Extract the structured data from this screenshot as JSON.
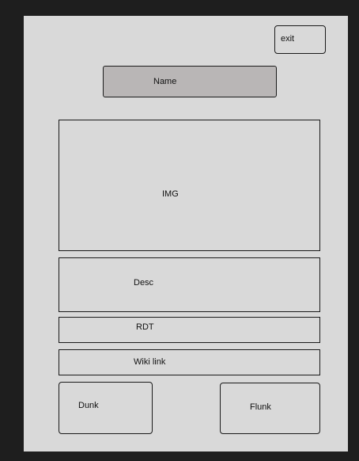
{
  "header": {
    "exit_label": "exit",
    "name_label": "Name"
  },
  "content": {
    "image_label": "IMG",
    "description_label": "Desc",
    "rdt_label": "RDT",
    "wiki_link_label": "Wiki link"
  },
  "actions": {
    "dunk_label": "Dunk",
    "flunk_label": "Flunk"
  },
  "colors": {
    "background": "#1e1e1e",
    "panel": "#d9d9d9",
    "name_fill": "#b9b6b6",
    "border": "#1a1a1a"
  }
}
